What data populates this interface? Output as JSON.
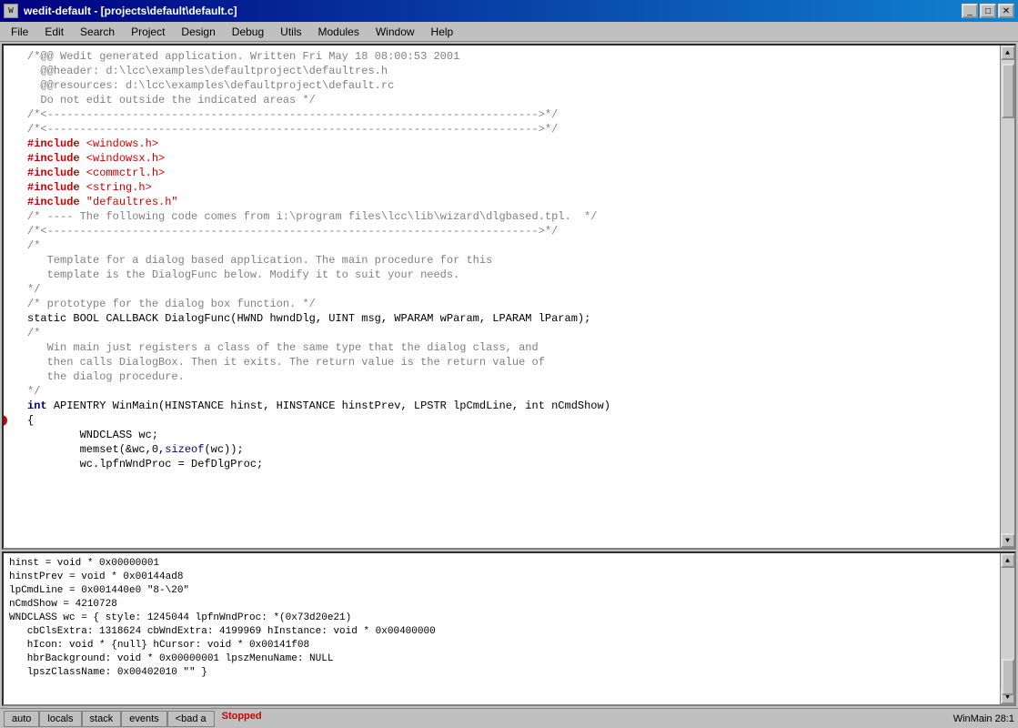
{
  "titleBar": {
    "title": "wedit-default - [projects\\default\\default.c]",
    "icon": "W",
    "buttons": {
      "minimize": "_",
      "maximize": "□",
      "close": "✕"
    }
  },
  "menuBar": {
    "items": [
      "File",
      "Edit",
      "Search",
      "Project",
      "Design",
      "Debug",
      "Utils",
      "Modules",
      "Window",
      "Help"
    ]
  },
  "editor": {
    "lines": [
      {
        "id": 1,
        "text": "/*@@ Wedit generated application. Written Fri May 18 08:00:53 2001",
        "type": "comment"
      },
      {
        "id": 2,
        "text": "  @@header: d:\\lcc\\examples\\defaultproject\\defaultres.h",
        "type": "comment"
      },
      {
        "id": 3,
        "text": "  @@resources: d:\\lcc\\examples\\defaultproject\\default.rc",
        "type": "comment"
      },
      {
        "id": 4,
        "text": "  Do not edit outside the indicated areas */",
        "type": "comment"
      },
      {
        "id": 5,
        "text": "/*<--------------------------------------------------------------------------->*/",
        "type": "comment"
      },
      {
        "id": 6,
        "text": "/*<--------------------------------------------------------------------------->*/",
        "type": "comment"
      },
      {
        "id": 7,
        "text": "#include <windows.h>",
        "type": "include"
      },
      {
        "id": 8,
        "text": "#include <windowsx.h>",
        "type": "include"
      },
      {
        "id": 9,
        "text": "#include <commctrl.h>",
        "type": "include"
      },
      {
        "id": 10,
        "text": "#include <string.h>",
        "type": "include"
      },
      {
        "id": 11,
        "text": "#include \"defaultres.h\"",
        "type": "include"
      },
      {
        "id": 12,
        "text": "/* ---- The following code comes from i:\\program files\\lcc\\lib\\wizard\\dlgbased.tpl.  */",
        "type": "comment"
      },
      {
        "id": 13,
        "text": "/*<--------------------------------------------------------------------------->*/",
        "type": "comment"
      },
      {
        "id": 14,
        "text": "",
        "type": "normal"
      },
      {
        "id": 15,
        "text": "/*",
        "type": "comment"
      },
      {
        "id": 16,
        "text": "   Template for a dialog based application. The main procedure for this",
        "type": "comment"
      },
      {
        "id": 17,
        "text": "   template is the DialogFunc below. Modify it to suit your needs.",
        "type": "comment"
      },
      {
        "id": 18,
        "text": "*/",
        "type": "comment"
      },
      {
        "id": 19,
        "text": "/* prototype for the dialog box function. */",
        "type": "comment"
      },
      {
        "id": 20,
        "text": "static BOOL CALLBACK DialogFunc(HWND hwndDlg, UINT msg, WPARAM wParam, LPARAM lParam);",
        "type": "normal"
      },
      {
        "id": 21,
        "text": "/*",
        "type": "comment"
      },
      {
        "id": 22,
        "text": "   Win main just registers a class of the same type that the dialog class, and",
        "type": "comment"
      },
      {
        "id": 23,
        "text": "   then calls DialogBox. Then it exits. The return value is the return value of",
        "type": "comment"
      },
      {
        "id": 24,
        "text": "   the dialog procedure.",
        "type": "comment"
      },
      {
        "id": 25,
        "text": "*/",
        "type": "comment"
      },
      {
        "id": 26,
        "text": "",
        "type": "normal"
      },
      {
        "id": 27,
        "text": "int APIENTRY WinMain(HINSTANCE hinst, HINSTANCE hinstPrev, LPSTR lpCmdLine, int nCmdShow)",
        "type": "func-decl"
      },
      {
        "id": 28,
        "text": "{",
        "type": "highlighted",
        "breakpoint": true
      },
      {
        "id": 29,
        "text": "        WNDCLASS wc;",
        "type": "normal"
      },
      {
        "id": 30,
        "text": "",
        "type": "normal"
      },
      {
        "id": 31,
        "text": "        memset(&wc,0,sizeof(wc));",
        "type": "normal"
      },
      {
        "id": 32,
        "text": "        wc.lpfnWndProc = DefDlgProc;",
        "type": "normal"
      }
    ]
  },
  "debugOutput": {
    "lines": [
      "hinst = void * 0x00000001",
      "hinstPrev = void * 0x00144ad8",
      "lpCmdLine = 0x001440e0 \"8-\\20\"",
      "nCmdShow = 4210728",
      "WNDCLASS wc = { style: 1245044 lpfnWndProc: *(0x73d20e21)",
      "   cbClsExtra: 1318624 cbWndExtra: 4199969 hInstance: void * 0x00400000",
      "   hIcon: void * {null} hCursor: void * 0x00141f08",
      "   hbrBackground: void * 0x00000001 lpszMenuName: NULL",
      "   lpszClassName: 0x00402010 \"\" }"
    ]
  },
  "statusBar": {
    "tabs": [
      "auto",
      "locals",
      "stack",
      "events",
      "<bad a"
    ],
    "status": "Stopped",
    "position": "WinMain 28:1"
  }
}
